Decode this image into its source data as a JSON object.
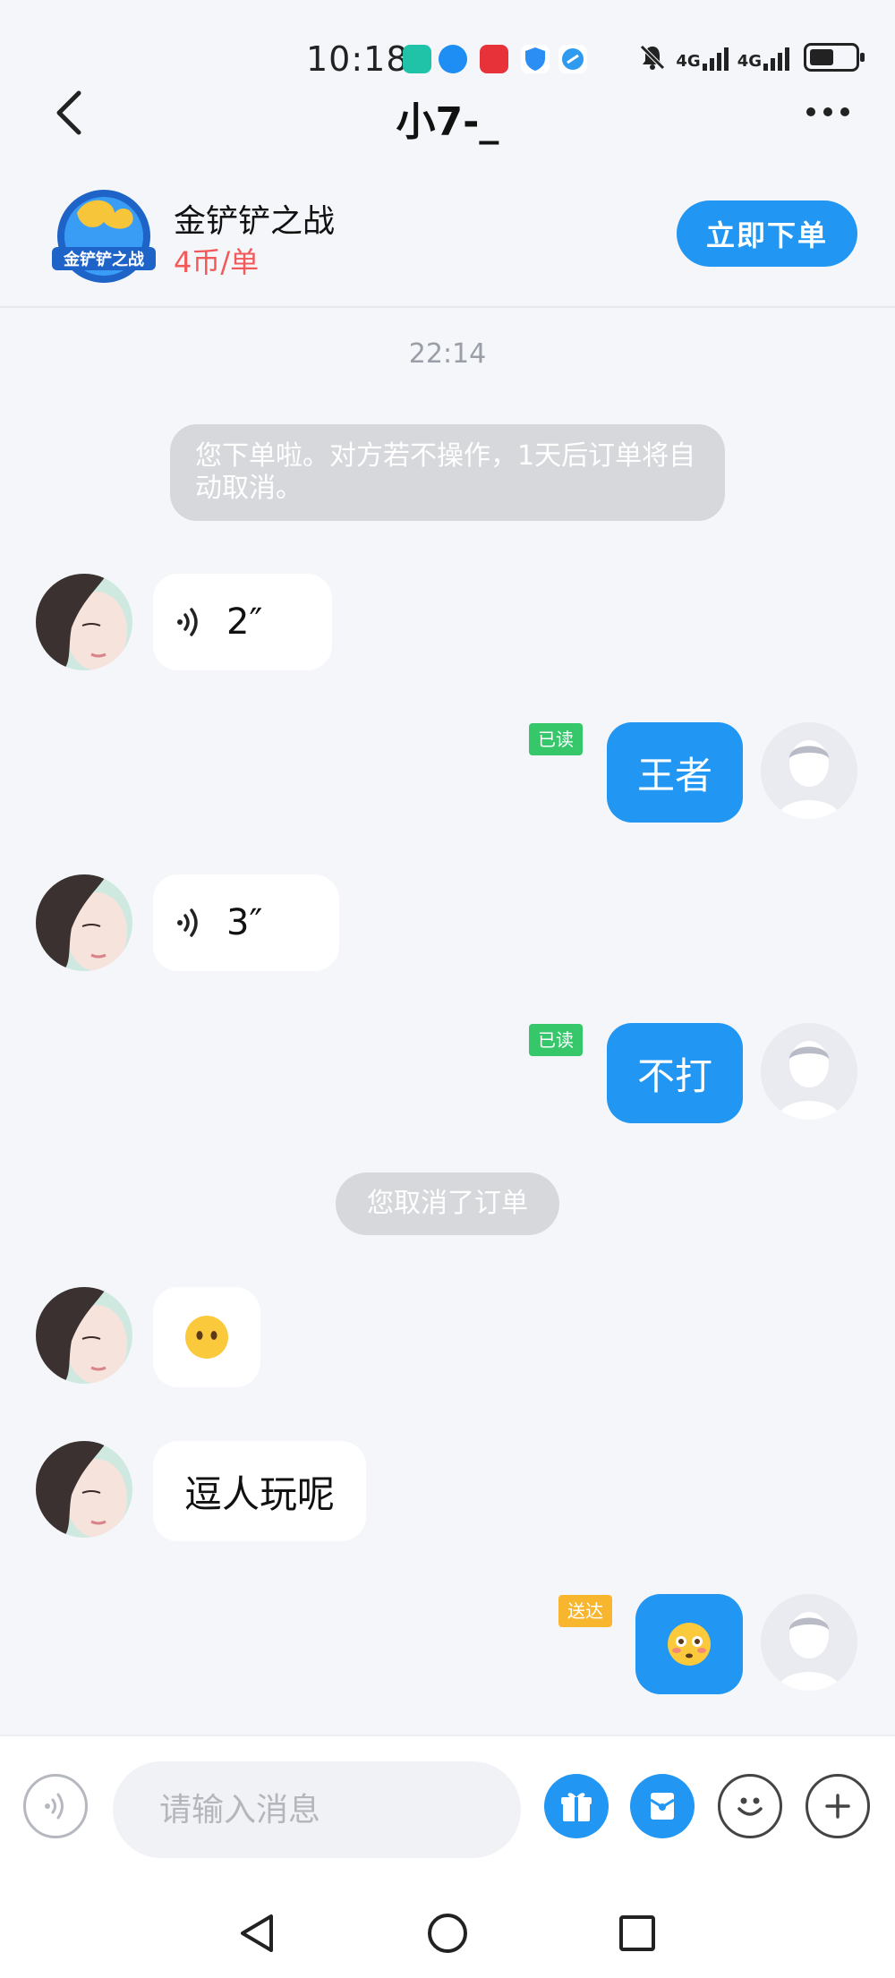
{
  "status_bar": {
    "time": "10:18",
    "network_1": "4G",
    "network_2": "4G",
    "battery_level": 0.55
  },
  "header": {
    "title": "小7-_"
  },
  "product": {
    "name": "金铲铲之战",
    "price": "4币/单",
    "order_button": "立即下单",
    "logo_text": "金铲铲之战",
    "price_color": "#f25a5a",
    "accent_color": "#2196f3"
  },
  "chat": {
    "timestamp": "22:14",
    "system_order_notice": "您下单啦。对方若不操作，1天后订单将自动取消。",
    "system_cancel_notice": "您取消了订单",
    "messages": [
      {
        "side": "in",
        "type": "voice",
        "duration": "2″"
      },
      {
        "side": "out",
        "type": "text",
        "text": "王者",
        "status": "已读"
      },
      {
        "side": "in",
        "type": "voice",
        "duration": "3″"
      },
      {
        "side": "out",
        "type": "text",
        "text": "不打",
        "status": "已读"
      },
      {
        "side": "in",
        "type": "emoji",
        "emoji": "no-mouth-face-icon"
      },
      {
        "side": "in",
        "type": "text",
        "text": "逗人玩呢"
      },
      {
        "side": "out",
        "type": "emoji",
        "emoji": "flushed-face-icon",
        "status": "送达"
      }
    ]
  },
  "input_bar": {
    "placeholder": "请输入消息"
  }
}
